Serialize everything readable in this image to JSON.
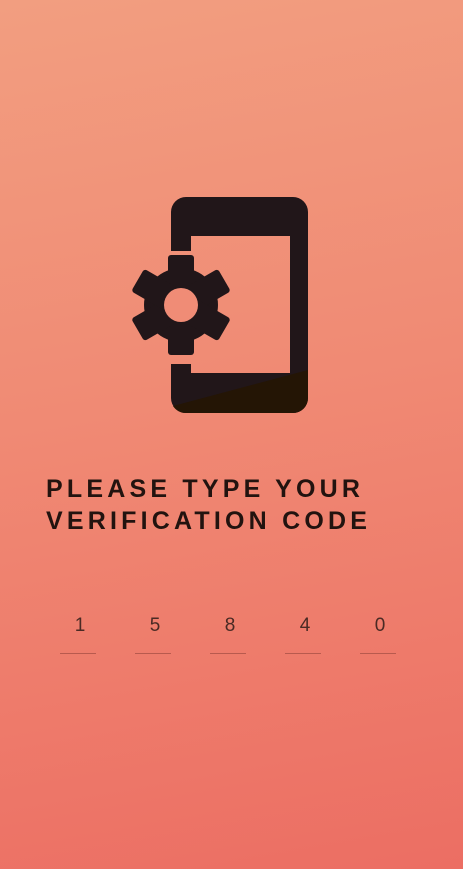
{
  "icon": "phone-settings-icon",
  "title": {
    "line1": "PLEASE TYPE YOUR",
    "line2": "VERIFICATION CODE"
  },
  "code": [
    "1",
    "5",
    "8",
    "4",
    "0"
  ],
  "colors": {
    "icon": "#211619",
    "text": "#22130f"
  }
}
